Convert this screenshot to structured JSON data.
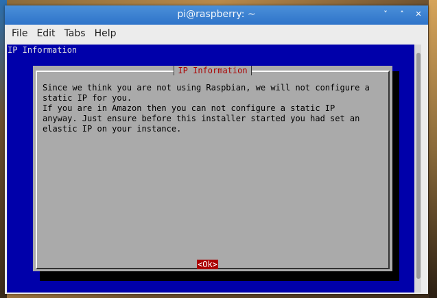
{
  "window": {
    "title": "pi@raspberry: ~",
    "controls": [
      "˅",
      "˄",
      "✕"
    ]
  },
  "menubar": {
    "items": [
      "File",
      "Edit",
      "Tabs",
      "Help"
    ]
  },
  "terminal": {
    "backtitle": "IP Information",
    "dialog": {
      "title": "IP Information",
      "message_lines": [
        "Since we think you are not using Raspbian, we will not configure a",
        "static IP for you.",
        "If you are in Amazon then you can not configure a static IP",
        "anyway. Just ensure before this installer started you had set an",
        "elastic IP on your instance."
      ],
      "ok_label": "<Ok>"
    }
  },
  "colors": {
    "terminal_bg": "#0000aa",
    "dialog_bg": "#aaaaaa",
    "dialog_title": "#aa0000",
    "button_bg": "#aa0000",
    "titlebar": "#2f74c9"
  }
}
